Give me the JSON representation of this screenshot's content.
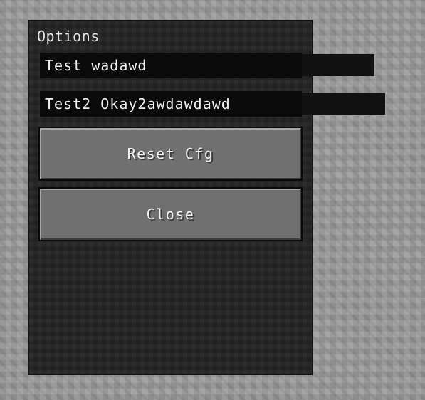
{
  "window": {
    "title": "Options"
  },
  "fields": [
    {
      "value": "Test wadawd"
    },
    {
      "value": "Test2 Okay2awdawdawd"
    }
  ],
  "buttons": {
    "reset_label": "Reset Cfg",
    "close_label": "Close"
  }
}
